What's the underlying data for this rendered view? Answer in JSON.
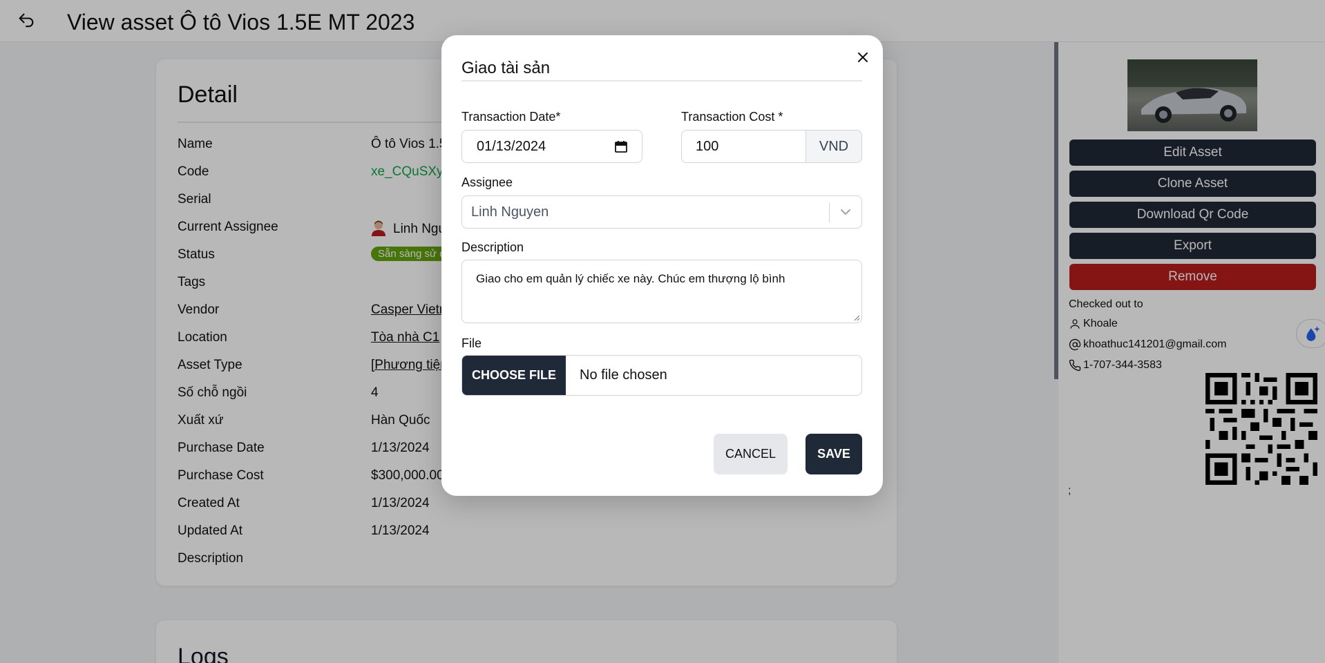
{
  "header": {
    "title": "View asset Ô tô Vios 1.5E MT 2023",
    "back_icon": "undo-arrow-icon"
  },
  "detail": {
    "heading": "Detail",
    "rows": [
      {
        "label": "Name",
        "value": "Ô tô Vios 1.5"
      },
      {
        "label": "Code",
        "value": "xe_CQuSXya"
      },
      {
        "label": "Serial",
        "value": ""
      },
      {
        "label": "Current Assignee",
        "value": "Linh Ngu"
      },
      {
        "label": "Status",
        "value": "Sẵn sàng sử d"
      },
      {
        "label": "Tags",
        "value": ""
      },
      {
        "label": "Vendor",
        "value": "Casper Vietn"
      },
      {
        "label": "Location",
        "value": "Tòa nhà C1"
      },
      {
        "label": "Asset Type",
        "value": "[Phương tiện"
      },
      {
        "label": "Số chỗ ngồi",
        "value": "4"
      },
      {
        "label": "Xuất xứ",
        "value": "Hàn Quốc"
      },
      {
        "label": "Purchase Date",
        "value": "1/13/2024"
      },
      {
        "label": "Purchase Cost",
        "value": "$300,000.00"
      },
      {
        "label": "Created At",
        "value": "1/13/2024"
      },
      {
        "label": "Updated At",
        "value": "1/13/2024"
      },
      {
        "label": "Description",
        "value": ""
      }
    ],
    "status_color": "#65a30d",
    "code_color": "#16a34a"
  },
  "logs": {
    "heading": "Logs"
  },
  "sidebar": {
    "buttons": {
      "edit": "Edit Asset",
      "clone": "Clone Asset",
      "qr": "Download Qr Code",
      "export": "Export",
      "remove": "Remove"
    },
    "checked_out_title": "Checked out to",
    "user_name": "Khoale",
    "email": "khoathuc141201@gmail.com",
    "phone": "1-707-344-3583",
    "trailing_text": ";",
    "remove_color": "#b91c1c",
    "dark_button_color": "#1f2937"
  },
  "modal": {
    "title": "Giao tài sản",
    "transaction_date_label": "Transaction Date*",
    "transaction_date_value": "01/13/2024",
    "transaction_cost_label": "Transaction Cost *",
    "transaction_cost_value": "100",
    "currency": "VND",
    "assignee_label": "Assignee",
    "assignee_value": "Linh Nguyen",
    "description_label": "Description",
    "description_value": "Giao cho em quản lý chiếc xe này. Chúc em thượng lộ bình",
    "file_label": "File",
    "choose_file": "CHOOSE FILE",
    "no_file": "No file chosen",
    "cancel": "CANCEL",
    "save": "SAVE"
  }
}
